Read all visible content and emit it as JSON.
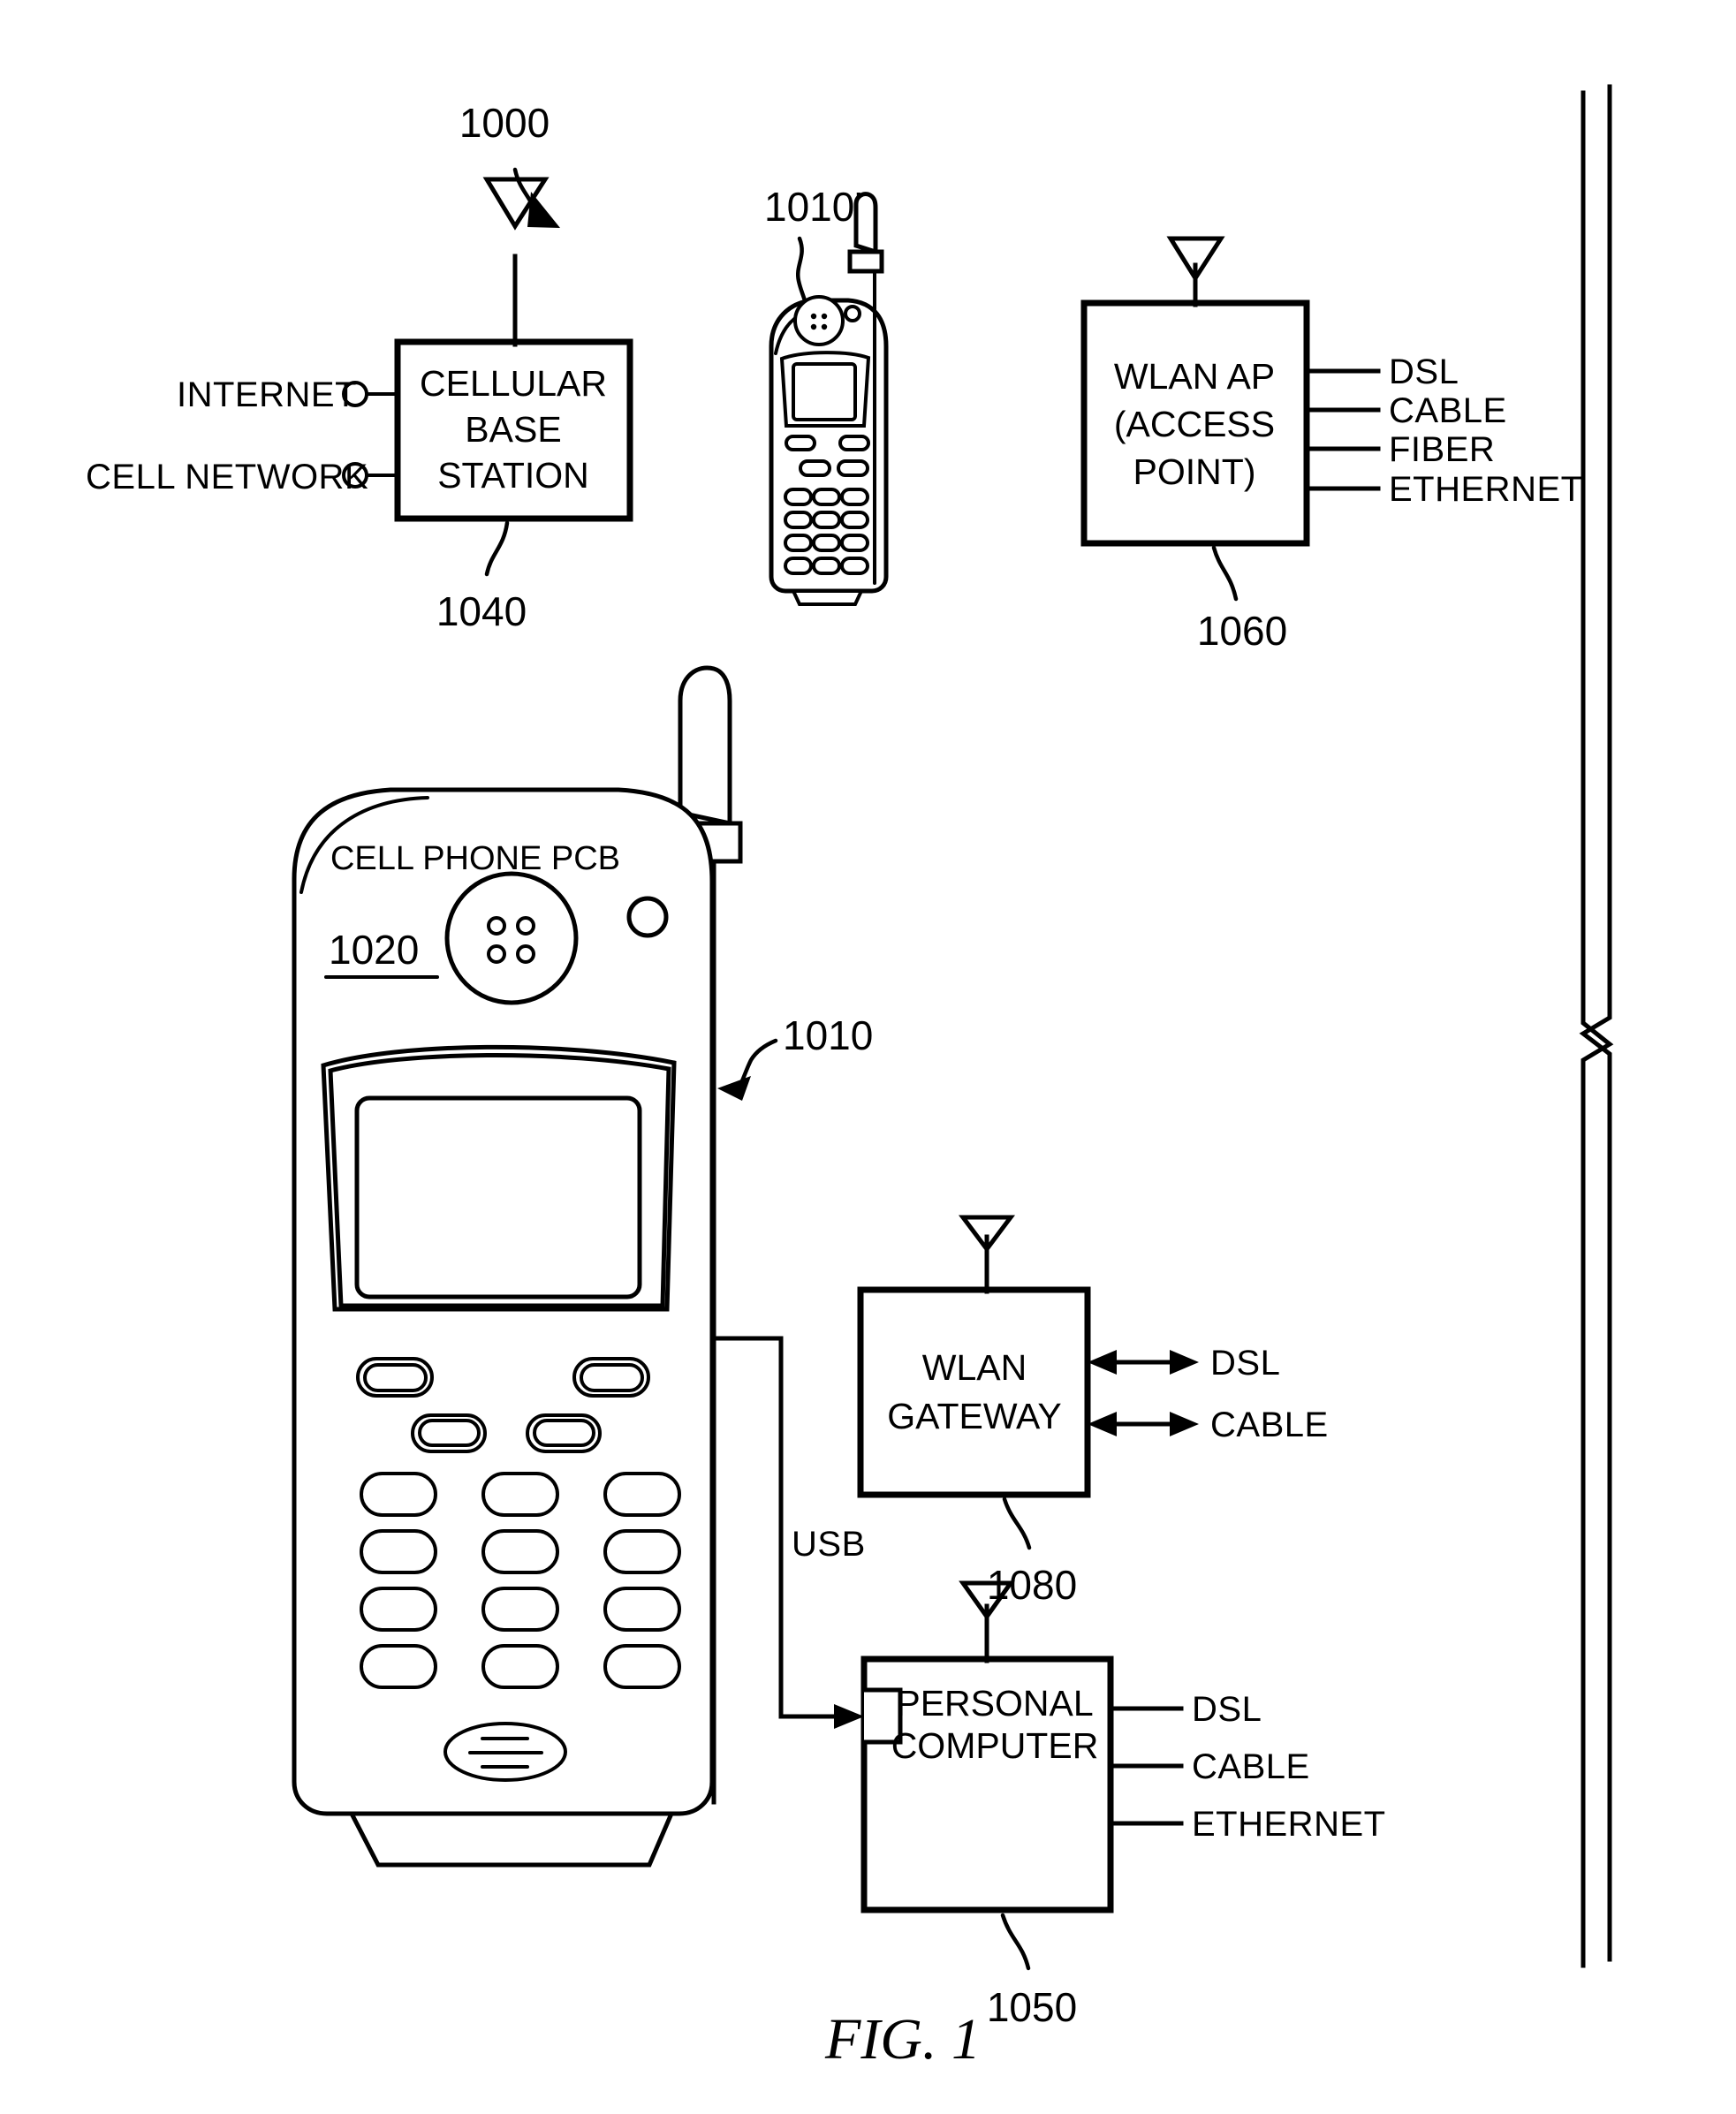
{
  "figure": {
    "caption": "FIG. 1",
    "system_ref": "1000"
  },
  "inputs": {
    "internet_label": "INTERNET",
    "cell_network_label": "CELL NETWORK"
  },
  "base_station": {
    "line1": "CELLULAR",
    "line2": "BASE",
    "line3": "STATION",
    "ref": "1040"
  },
  "small_phone": {
    "ref": "1010'"
  },
  "wlan_ap": {
    "line1": "WLAN AP",
    "line2": "(ACCESS",
    "line3": "POINT)",
    "ref": "1060",
    "ports": [
      "DSL",
      "CABLE",
      "FIBER",
      "ETHERNET"
    ]
  },
  "main_phone": {
    "pcb_label": "CELL PHONE PCB",
    "pcb_ref": "1020",
    "phone_ref": "1010"
  },
  "wlan_gateway": {
    "line1": "WLAN",
    "line2": "GATEWAY",
    "ref": "1080",
    "ports": [
      "DSL",
      "CABLE"
    ]
  },
  "personal_computer": {
    "line1": "PERSONAL",
    "line2": "COMPUTER",
    "ref": "1050",
    "ports": [
      "DSL",
      "CABLE",
      "ETHERNET"
    ]
  },
  "connections": {
    "usb_label": "USB"
  },
  "colors": {
    "ink": "#000000",
    "paper": "#ffffff"
  }
}
